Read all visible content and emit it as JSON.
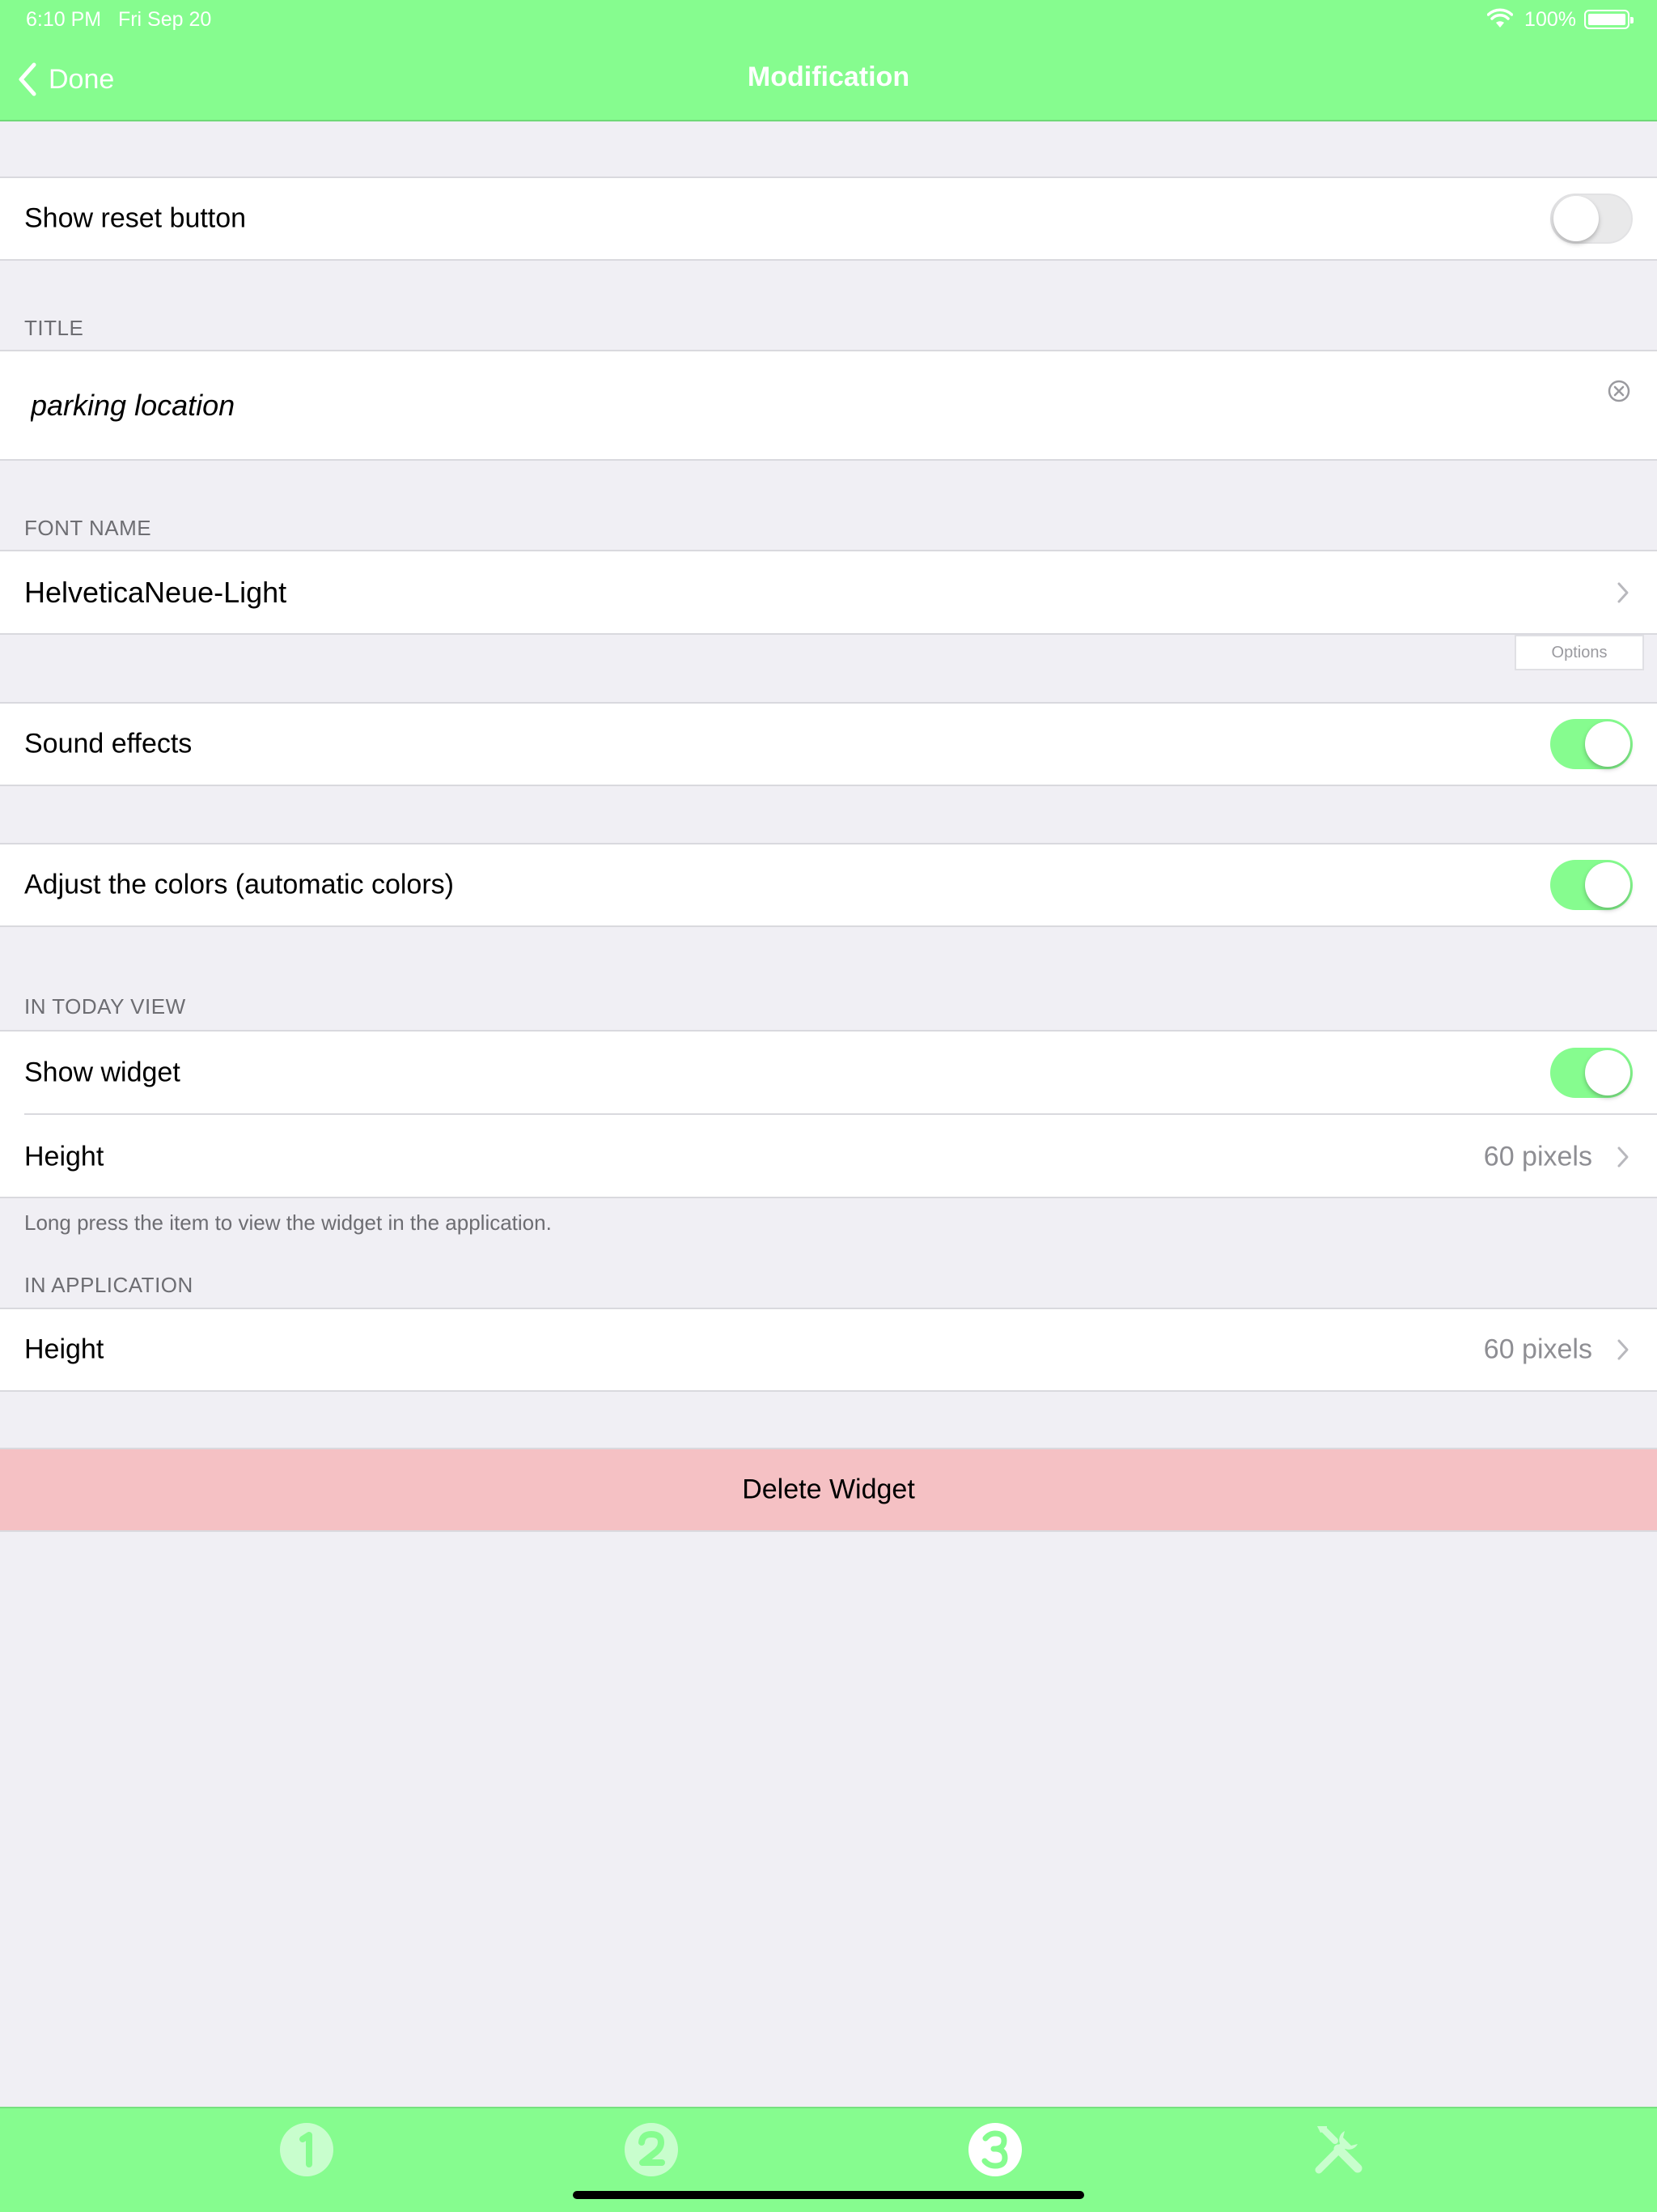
{
  "status_bar": {
    "time": "6:10 PM",
    "date": "Fri Sep 20",
    "battery": "100%"
  },
  "nav": {
    "back_label": "Done",
    "title": "Modification"
  },
  "rows": {
    "show_reset": {
      "label": "Show reset button",
      "on": false
    },
    "title_section": "TITLE",
    "title_value": "parking location",
    "font_section": "FONT NAME",
    "font_name": "HelveticaNeue-Light",
    "options_label": "Options",
    "sound_effects": {
      "label": "Sound effects",
      "on": true
    },
    "adjust_colors": {
      "label": "Adjust the colors (automatic colors)",
      "on": true
    },
    "today_section": "IN TODAY VIEW",
    "show_widget": {
      "label": "Show widget",
      "on": true
    },
    "today_height": {
      "label": "Height",
      "value": "60 pixels"
    },
    "today_footer": "Long press the item to view the widget in the application.",
    "app_section": "IN APPLICATION",
    "app_height": {
      "label": "Height",
      "value": "60 pixels"
    },
    "delete_label": "Delete Widget"
  },
  "tabs": [
    {
      "icon": "tab-1-icon",
      "selected": false
    },
    {
      "icon": "tab-2-icon",
      "selected": false
    },
    {
      "icon": "tab-3-icon",
      "selected": true
    },
    {
      "icon": "tools-icon",
      "selected": false
    }
  ],
  "colors": {
    "accent": "#86fc8f",
    "background": "#f0eff4",
    "delete_bg": "#f5c1c4",
    "secondary_text": "#8e8e93"
  }
}
